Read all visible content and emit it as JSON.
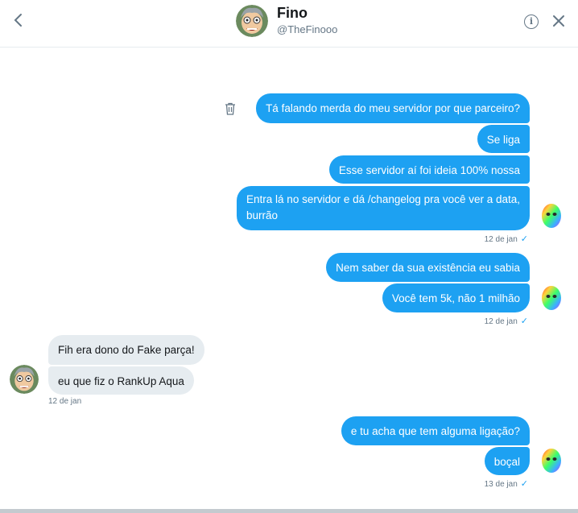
{
  "header": {
    "name": "Fino",
    "handle": "@TheFinooo",
    "icons": {
      "back": "chevron-left-icon",
      "info": "info-icon",
      "close": "close-icon"
    }
  },
  "messages": {
    "m1": "Tá falando merda do meu servidor por que parceiro?",
    "m2": "Se liga",
    "m3": "Esse servidor aí foi ideia 100% nossa",
    "m4_line1": "Entra lá no servidor e dá /changelog pra você ver a data,",
    "m4_line2": "burrão",
    "ts1": "12 de jan",
    "m5": "Nem saber da sua existência eu sabia",
    "m6": "Você tem 5k, não 1 milhão",
    "ts2": "12 de jan",
    "m7": "Fih era dono do Fake parça!",
    "m8": "eu que fiz o RankUp Aqua",
    "ts3": "12 de jan",
    "m9": "e tu acha que tem alguma ligação?",
    "m10": "boçal",
    "ts4": "13 de jan"
  },
  "colors": {
    "outgoing_bubble": "#1da1f2",
    "incoming_bubble": "#e6ecf0",
    "muted_text": "#657786"
  }
}
